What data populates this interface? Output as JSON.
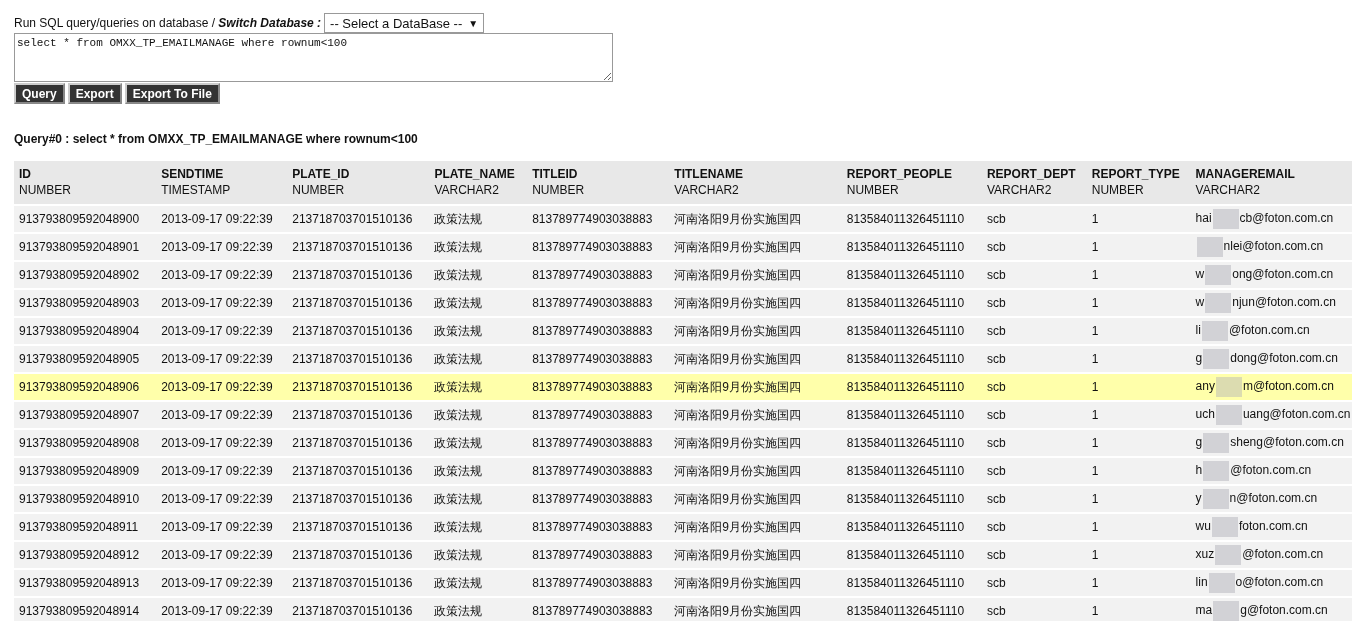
{
  "prompt": {
    "label": "Run SQL query/queries on database / ",
    "switch_label": "Switch Database :",
    "database_select": {
      "value": "-- Select a DataBase --",
      "arrow": "▼"
    }
  },
  "query_text": "select * from OMXX_TP_EMAILMANAGE where rownum<100",
  "buttons": [
    "Query",
    "Export",
    "Export To File"
  ],
  "result_title": "Query#0 : select * from OMXX_TP_EMAILMANAGE where rownum<100",
  "table": {
    "columns": [
      {
        "name": "ID",
        "type": "NUMBER"
      },
      {
        "name": "SENDTIME",
        "type": "TIMESTAMP"
      },
      {
        "name": "PLATE_ID",
        "type": "NUMBER"
      },
      {
        "name": "PLATE_NAME",
        "type": "VARCHAR2"
      },
      {
        "name": "TITLEID",
        "type": "NUMBER"
      },
      {
        "name": "TITLENAME",
        "type": "VARCHAR2"
      },
      {
        "name": "REPORT_PEOPLE",
        "type": "NUMBER"
      },
      {
        "name": "REPORT_DEPT",
        "type": "VARCHAR2"
      },
      {
        "name": "REPORT_TYPE",
        "type": "NUMBER"
      },
      {
        "name": "MANAGEREMAIL",
        "type": "VARCHAR2"
      }
    ],
    "rows": [
      {
        "highlighted": false,
        "cells": [
          "913793809592048900",
          "2013-09-17 09:22:39",
          "213718703701510136",
          "政策法规",
          "813789774903038883",
          "河南洛阳9月份实施国四",
          "813584011326451110",
          "scb",
          "1"
        ],
        "email": {
          "visible_start": "hai",
          "visible_end": "cb@foton.com.cn"
        }
      },
      {
        "highlighted": false,
        "cells": [
          "913793809592048901",
          "2013-09-17 09:22:39",
          "213718703701510136",
          "政策法规",
          "813789774903038883",
          "河南洛阳9月份实施国四",
          "813584011326451110",
          "scb",
          "1"
        ],
        "email": {
          "visible_end": "nlei@foton.com.cn"
        }
      },
      {
        "highlighted": false,
        "cells": [
          "913793809592048902",
          "2013-09-17 09:22:39",
          "213718703701510136",
          "政策法规",
          "813789774903038883",
          "河南洛阳9月份实施国四",
          "813584011326451110",
          "scb",
          "1"
        ],
        "email": {
          "visible_start": "w",
          "visible_end": "ong@foton.com.cn"
        }
      },
      {
        "highlighted": false,
        "cells": [
          "913793809592048903",
          "2013-09-17 09:22:39",
          "213718703701510136",
          "政策法规",
          "813789774903038883",
          "河南洛阳9月份实施国四",
          "813584011326451110",
          "scb",
          "1"
        ],
        "email": {
          "visible_start": "w",
          "visible_end": "njun@foton.com.cn"
        }
      },
      {
        "highlighted": false,
        "cells": [
          "913793809592048904",
          "2013-09-17 09:22:39",
          "213718703701510136",
          "政策法规",
          "813789774903038883",
          "河南洛阳9月份实施国四",
          "813584011326451110",
          "scb",
          "1"
        ],
        "email": {
          "visible_start": "li",
          "visible_end": "@foton.com.cn"
        }
      },
      {
        "highlighted": false,
        "cells": [
          "913793809592048905",
          "2013-09-17 09:22:39",
          "213718703701510136",
          "政策法规",
          "813789774903038883",
          "河南洛阳9月份实施国四",
          "813584011326451110",
          "scb",
          "1"
        ],
        "email": {
          "visible_start": "g",
          "visible_end": "dong@foton.com.cn"
        }
      },
      {
        "highlighted": true,
        "cells": [
          "913793809592048906",
          "2013-09-17 09:22:39",
          "213718703701510136",
          "政策法规",
          "813789774903038883",
          "河南洛阳9月份实施国四",
          "813584011326451110",
          "scb",
          "1"
        ],
        "email": {
          "visible_start": "any",
          "visible_end": "m@foton.com.cn"
        }
      },
      {
        "highlighted": false,
        "cells": [
          "913793809592048907",
          "2013-09-17 09:22:39",
          "213718703701510136",
          "政策法规",
          "813789774903038883",
          "河南洛阳9月份实施国四",
          "813584011326451110",
          "scb",
          "1"
        ],
        "email": {
          "visible_start": "uch",
          "visible_end": "uang@foton.com.cn"
        }
      },
      {
        "highlighted": false,
        "cells": [
          "913793809592048908",
          "2013-09-17 09:22:39",
          "213718703701510136",
          "政策法规",
          "813789774903038883",
          "河南洛阳9月份实施国四",
          "813584011326451110",
          "scb",
          "1"
        ],
        "email": {
          "visible_start": "g",
          "visible_end": "sheng@foton.com.cn"
        }
      },
      {
        "highlighted": false,
        "cells": [
          "913793809592048909",
          "2013-09-17 09:22:39",
          "213718703701510136",
          "政策法规",
          "813789774903038883",
          "河南洛阳9月份实施国四",
          "813584011326451110",
          "scb",
          "1"
        ],
        "email": {
          "visible_start": "h",
          "visible_end": "@foton.com.cn"
        }
      },
      {
        "highlighted": false,
        "cells": [
          "913793809592048910",
          "2013-09-17 09:22:39",
          "213718703701510136",
          "政策法规",
          "813789774903038883",
          "河南洛阳9月份实施国四",
          "813584011326451110",
          "scb",
          "1"
        ],
        "email": {
          "visible_start": "y",
          "visible_end": "n@foton.com.cn"
        }
      },
      {
        "highlighted": false,
        "cells": [
          "913793809592048911",
          "2013-09-17 09:22:39",
          "213718703701510136",
          "政策法规",
          "813789774903038883",
          "河南洛阳9月份实施国四",
          "813584011326451110",
          "scb",
          "1"
        ],
        "email": {
          "visible_start": "wu",
          "visible_end": "foton.com.cn"
        }
      },
      {
        "highlighted": false,
        "cells": [
          "913793809592048912",
          "2013-09-17 09:22:39",
          "213718703701510136",
          "政策法规",
          "813789774903038883",
          "河南洛阳9月份实施国四",
          "813584011326451110",
          "scb",
          "1"
        ],
        "email": {
          "visible_start": "xuz",
          "visible_end": "@foton.com.cn"
        }
      },
      {
        "highlighted": false,
        "cells": [
          "913793809592048913",
          "2013-09-17 09:22:39",
          "213718703701510136",
          "政策法规",
          "813789774903038883",
          "河南洛阳9月份实施国四",
          "813584011326451110",
          "scb",
          "1"
        ],
        "email": {
          "visible_start": "lin",
          "visible_end": "o@foton.com.cn"
        }
      },
      {
        "highlighted": false,
        "cells": [
          "913793809592048914",
          "2013-09-17 09:22:39",
          "213718703701510136",
          "政策法规",
          "813789774903038883",
          "河南洛阳9月份实施国四",
          "813584011326451110",
          "scb",
          "1"
        ],
        "email": {
          "visible_start": "ma",
          "visible_end": "g@foton.com.cn"
        }
      }
    ]
  }
}
